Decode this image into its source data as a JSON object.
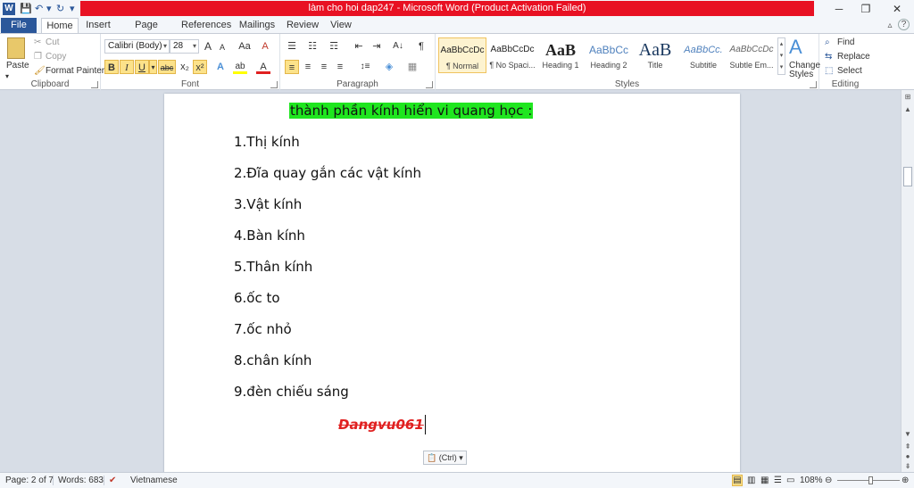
{
  "window": {
    "title": "làm cho hoi dap247  -  Microsoft Word (Product Activation Failed)",
    "minimize_glyph": "─",
    "restore_glyph": "❐",
    "close_glyph": "✕"
  },
  "qat": {
    "app_icon": "W",
    "save_glyph": "💾",
    "undo_glyph": "↶",
    "redo_glyph": "↻",
    "customize_glyph": "▾"
  },
  "tabs": {
    "file": "File",
    "items": [
      "Home",
      "Insert",
      "Page Layout",
      "References",
      "Mailings",
      "Review",
      "View"
    ],
    "active": "Home",
    "minimize_ribbon_glyph": "▵",
    "help_glyph": "?"
  },
  "ribbon": {
    "clipboard": {
      "label": "Clipboard",
      "paste": "Paste",
      "cut": "Cut",
      "copy": "Copy",
      "format_painter": "Format Painter"
    },
    "font": {
      "label": "Font",
      "family": "Calibri (Body)",
      "size": "28",
      "grow": "A",
      "shrink": "A",
      "change_case": "Aa",
      "clear": "A",
      "bold": "B",
      "italic": "I",
      "underline": "U",
      "strike": "abc",
      "subscript": "x₂",
      "superscript": "x²",
      "effects": "A",
      "highlight": "ab",
      "color": "A"
    },
    "paragraph": {
      "label": "Paragraph",
      "bullets": "☰",
      "numbering": "☷",
      "multilevel": "☶",
      "decrease_indent": "⇤",
      "increase_indent": "⇥",
      "sort": "A↓",
      "show_marks": "¶",
      "align_left": "≡",
      "align_center": "≡",
      "align_right": "≡",
      "justify": "≡",
      "line_spacing": "↕≡",
      "shading": "◈",
      "borders": "▦"
    },
    "styles": {
      "label": "Styles",
      "items": [
        {
          "sample": "AaBbCcDc",
          "name": "¶ Normal"
        },
        {
          "sample": "AaBbCcDc",
          "name": "¶ No Spaci..."
        },
        {
          "sample": "AaB",
          "name": "Heading 1"
        },
        {
          "sample": "AaBbCc",
          "name": "Heading 2"
        },
        {
          "sample": "AaB",
          "name": "Title"
        },
        {
          "sample": "AaBbCc.",
          "name": "Subtitle"
        },
        {
          "sample": "AaBbCcDc",
          "name": "Subtle Em..."
        }
      ],
      "change_styles_line1": "Change",
      "change_styles_line2": "Styles",
      "change_glyph": "A"
    },
    "editing": {
      "label": "Editing",
      "find": "Find",
      "replace": "Replace",
      "select": "Select"
    }
  },
  "document": {
    "heading": "thành phần kính hiển vi quang học :",
    "list": [
      "1.Thị kính",
      "2.Đĩa quay gắn các vật kính",
      "3.Vật kính",
      "4.Bàn kính",
      "5.Thân kính",
      "6.ốc to",
      "7.ốc nhỏ",
      "8.chân kính",
      "9.đèn chiếu sáng"
    ],
    "signature": "Dangvu061",
    "paste_options": "(Ctrl)"
  },
  "status": {
    "page": "Page: 2 of 7",
    "words": "Words: 683",
    "language": "Vietnamese",
    "zoom": "108%",
    "zoom_fraction": 0.54
  },
  "colors": {
    "accent": "#2b579a",
    "title_bar_alert": "#e81123",
    "highlight": "#1fe61f",
    "signature": "#e02020"
  }
}
